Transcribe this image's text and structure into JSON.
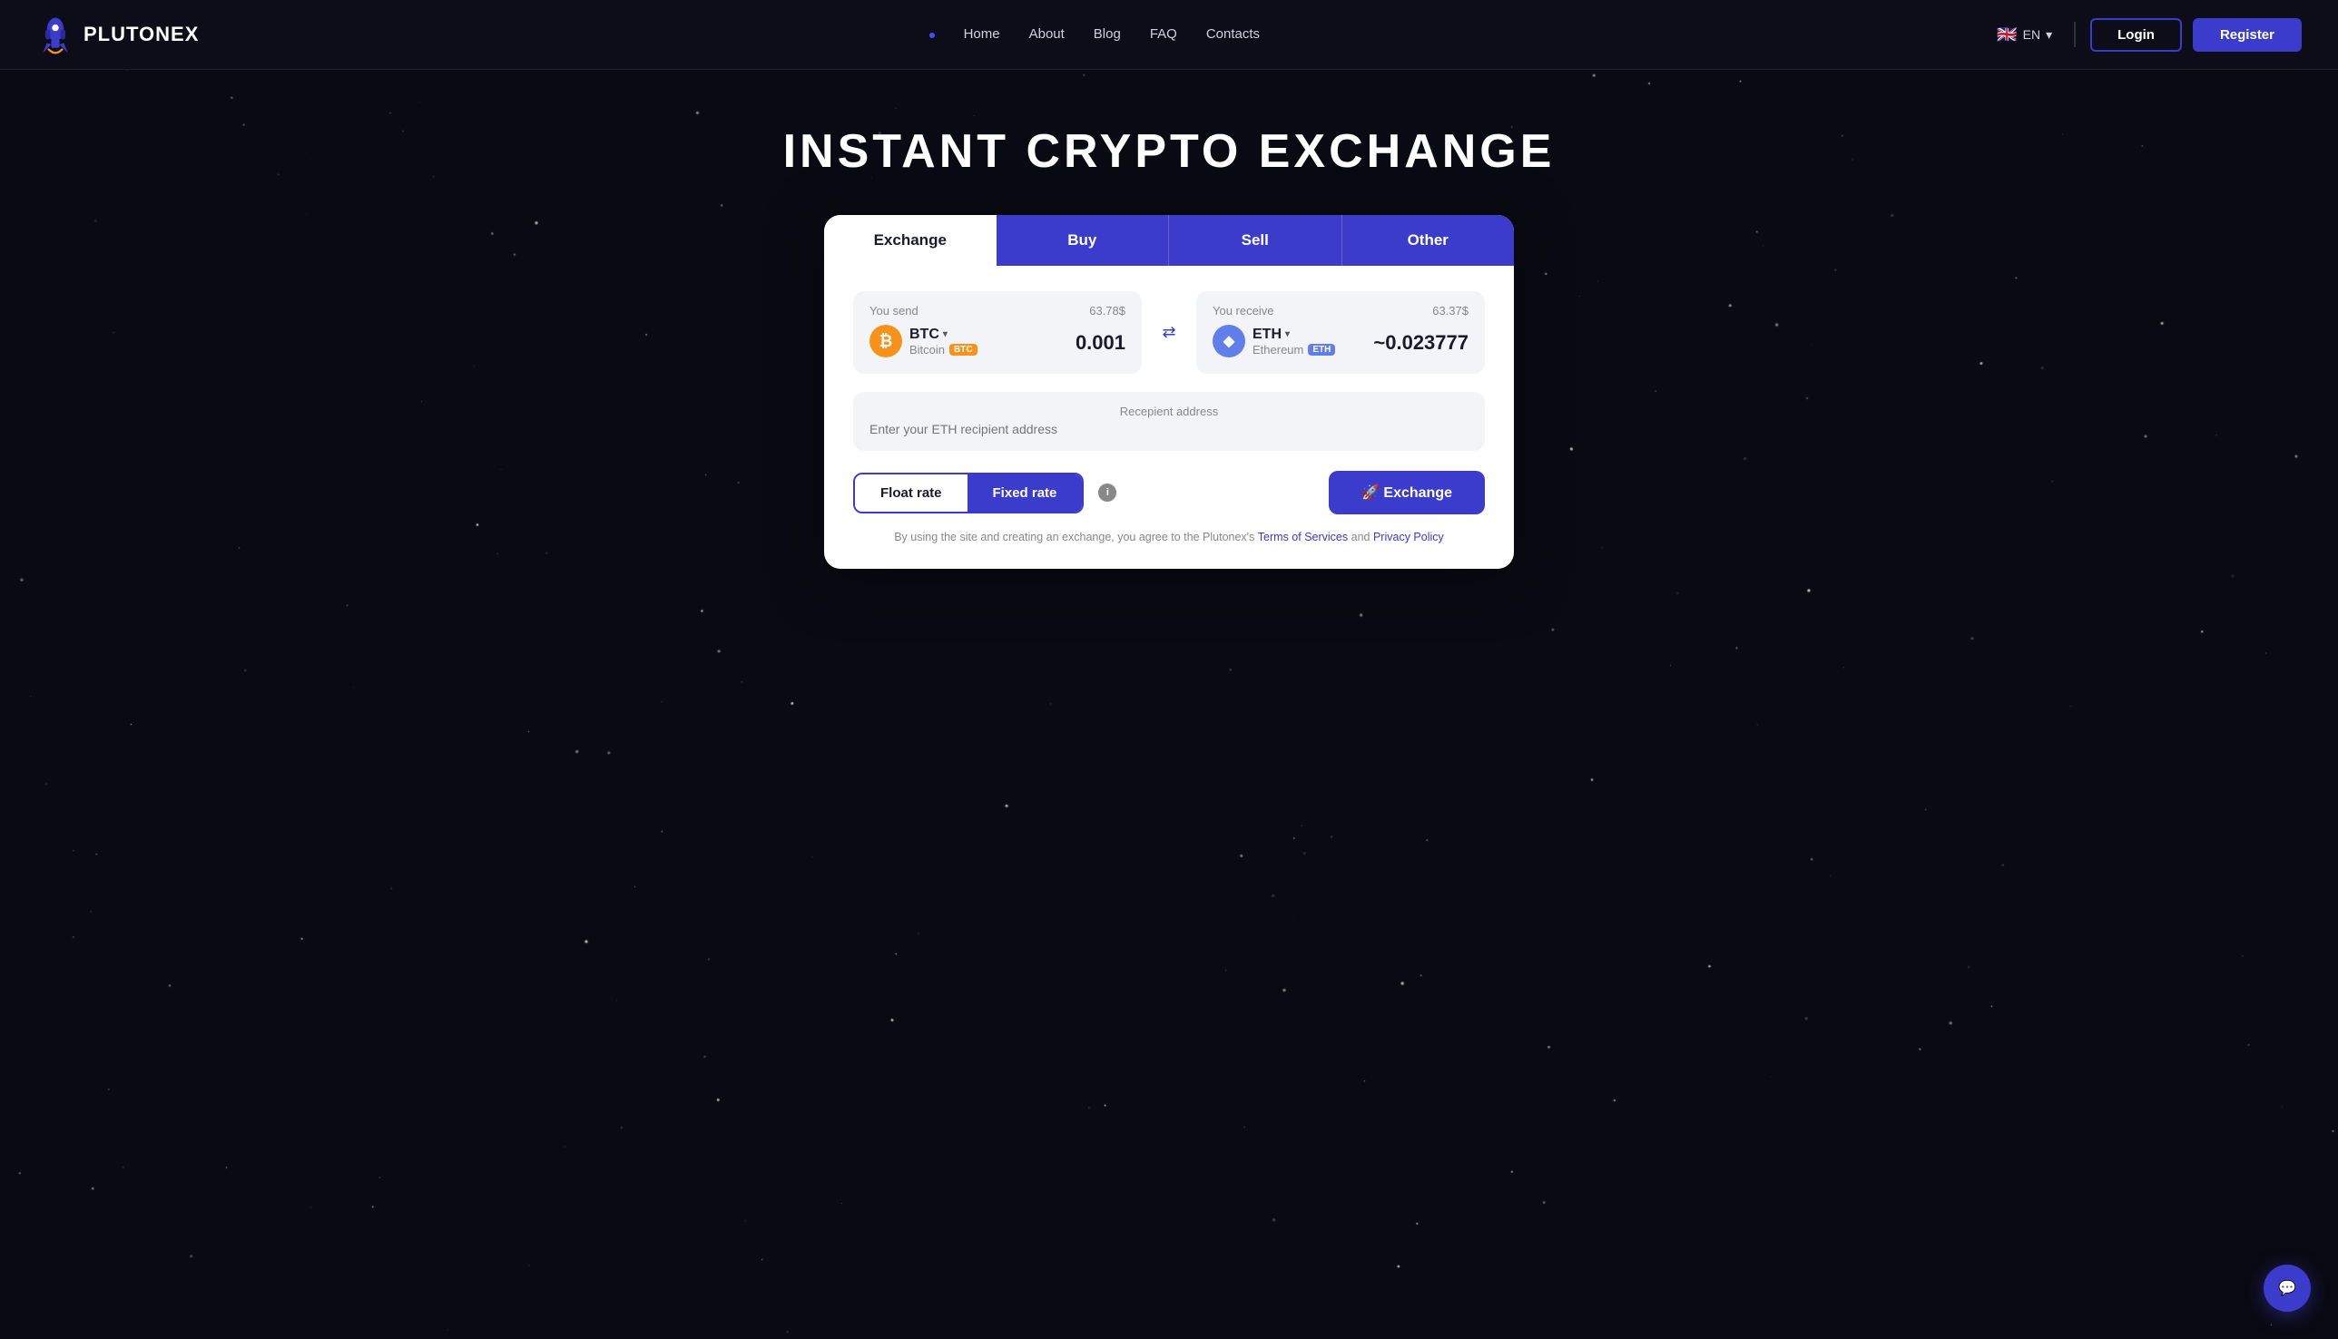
{
  "site": {
    "logo_text": "PLUTONEX",
    "title": "INSTANT CRYPTO EXCHANGE"
  },
  "nav": {
    "dot": "•",
    "items": [
      {
        "label": "Home",
        "href": "#"
      },
      {
        "label": "About",
        "href": "#"
      },
      {
        "label": "Blog",
        "href": "#"
      },
      {
        "label": "FAQ",
        "href": "#"
      },
      {
        "label": "Contacts",
        "href": "#"
      }
    ],
    "lang": "EN",
    "login": "Login",
    "register": "Register"
  },
  "exchange_card": {
    "tabs": [
      {
        "label": "Exchange",
        "active": true
      },
      {
        "label": "Buy"
      },
      {
        "label": "Sell"
      },
      {
        "label": "Other"
      }
    ],
    "send": {
      "label": "You send",
      "amount_usd": "63.78$",
      "coin_ticker": "BTC",
      "coin_chevron": "▾",
      "coin_name": "Bitcoin",
      "coin_badge": "BTC",
      "amount": "0.001"
    },
    "receive": {
      "label": "You receive",
      "amount_usd": "63.37$",
      "coin_ticker": "ETH",
      "coin_chevron": "▾",
      "coin_name": "Ethereum",
      "coin_badge": "ETH",
      "amount": "~0.023777"
    },
    "swap_icon": "⇄",
    "recipient": {
      "label": "Recepient address",
      "placeholder": "Enter your ETH recipient address"
    },
    "rates": {
      "float_label": "Float rate",
      "fixed_label": "Fixed rate"
    },
    "exchange_btn": "🚀 Exchange",
    "terms_text_before": "By using the site and creating an exchange, you agree to the Plutonex's ",
    "terms_of_service": "Terms of Services",
    "terms_text_middle": " and ",
    "privacy_policy": "Privacy Policy"
  },
  "chat_btn": {
    "icon": "💬"
  },
  "colors": {
    "brand_blue": "#3b3bcc",
    "bg_dark": "#0a0a14",
    "tab_active_bg": "#fff",
    "tab_inactive_bg": "#3b3bcc"
  }
}
